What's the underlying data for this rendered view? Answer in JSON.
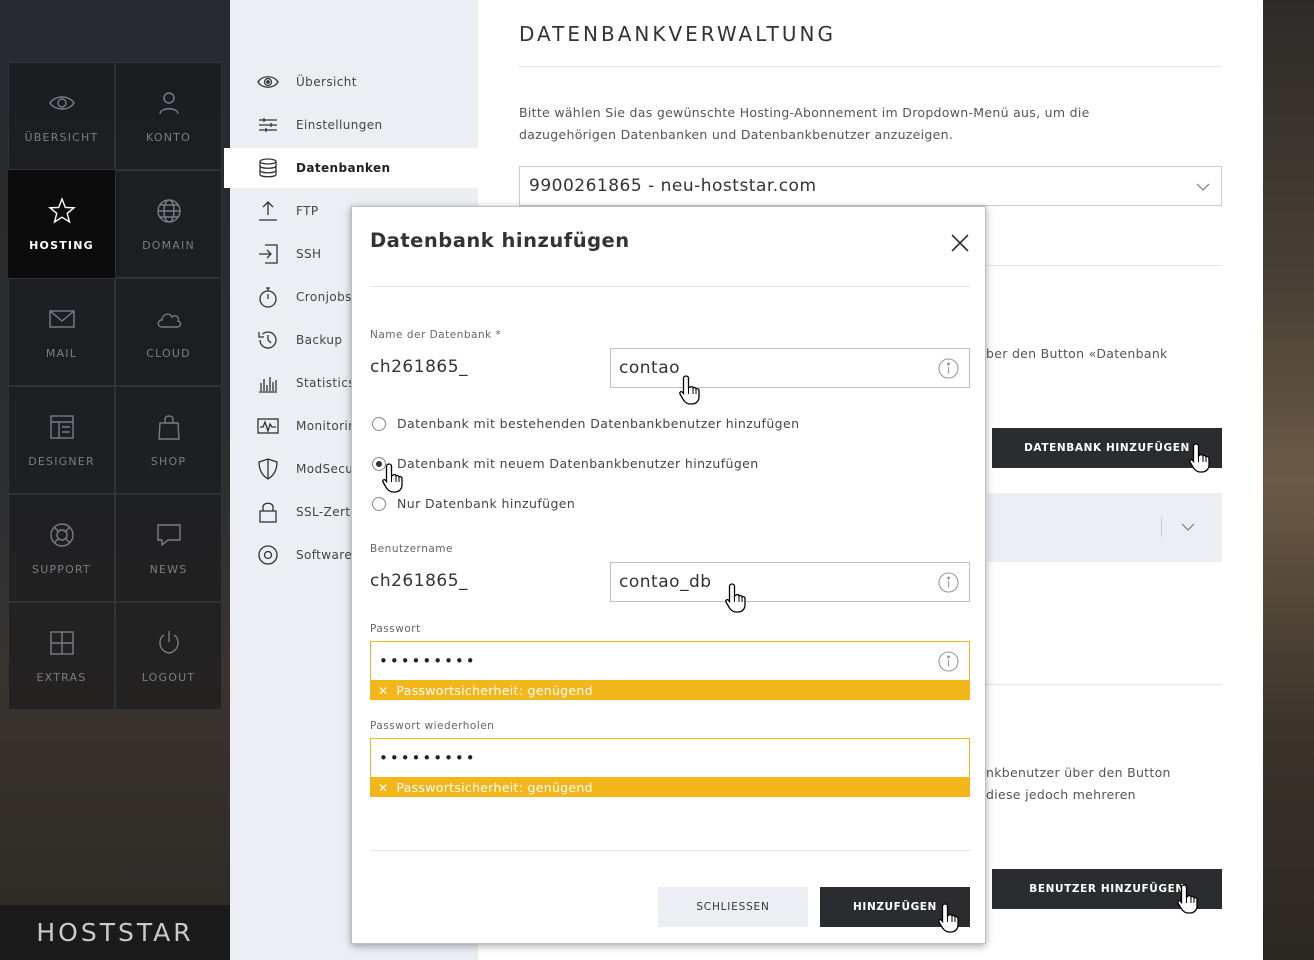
{
  "brand": {
    "logo_text": "HOSTSTAR"
  },
  "main_nav": [
    {
      "label": "ÜBERSICHT",
      "icon": "eye-icon"
    },
    {
      "label": "KONTO",
      "icon": "user-icon"
    },
    {
      "label": "HOSTING",
      "icon": "star-icon",
      "active": true
    },
    {
      "label": "DOMAIN",
      "icon": "globe-icon"
    },
    {
      "label": "MAIL",
      "icon": "mail-icon"
    },
    {
      "label": "CLOUD",
      "icon": "cloud-icon"
    },
    {
      "label": "DESIGNER",
      "icon": "layout-icon"
    },
    {
      "label": "SHOP",
      "icon": "shopping-bag-icon"
    },
    {
      "label": "SUPPORT",
      "icon": "lifebuoy-icon"
    },
    {
      "label": "NEWS",
      "icon": "speech-bubble-icon"
    },
    {
      "label": "EXTRAS",
      "icon": "plus-square-icon"
    },
    {
      "label": "LOGOUT",
      "icon": "power-icon"
    }
  ],
  "submenu": [
    {
      "label": "Übersicht",
      "icon": "eye-icon"
    },
    {
      "label": "Einstellungen",
      "icon": "sliders-icon"
    },
    {
      "label": "Datenbanken",
      "icon": "database-icon",
      "active": true
    },
    {
      "label": "FTP",
      "icon": "upload-icon"
    },
    {
      "label": "SSH",
      "icon": "login-icon"
    },
    {
      "label": "Cronjobs",
      "icon": "stopwatch-icon"
    },
    {
      "label": "Backup",
      "icon": "history-icon"
    },
    {
      "label": "Statistics",
      "icon": "bar-chart-icon"
    },
    {
      "label": "Monitoring",
      "icon": "pulse-icon"
    },
    {
      "label": "ModSecurity",
      "icon": "shield-icon"
    },
    {
      "label": "SSL-Zertifikate",
      "icon": "lock-icon"
    },
    {
      "label": "Software",
      "icon": "disc-icon"
    }
  ],
  "page": {
    "title": "DATENBANKVERWALTUNG",
    "intro": "Bitte wählen Sie das gewünschte Hosting-Abonnement im Dropdown-Menü aus, um die dazugehörigen Datenbanken und Datenbankbenutzer anzuzeigen.",
    "subscription_selected": "9900261865 - neu-hoststar.com",
    "bg_text_1": "ber den Button «Datenbank",
    "bg_text_2_line1": "nkbenutzer über den Button",
    "bg_text_2_line2": "diese jedoch mehreren",
    "add_db_button": "DATENBANK HINZUFÜGEN",
    "add_user_button": "BENUTZER HINZUFÜGEN"
  },
  "modal": {
    "title": "Datenbank hinzufügen",
    "db_name_label": "Name der Datenbank *",
    "db_prefix": "ch261865_",
    "db_name_value": "contao",
    "radio_options": [
      {
        "label": "Datenbank mit bestehenden Datenbankbenutzer hinzufügen",
        "checked": false
      },
      {
        "label": "Datenbank mit neuem Datenbankbenutzer hinzufügen",
        "checked": true
      },
      {
        "label": "Nur Datenbank hinzufügen",
        "checked": false
      }
    ],
    "username_label": "Benutzername",
    "user_prefix": "ch261865_",
    "username_value": "contao_db",
    "password_label": "Passwort",
    "password_value": "•••••••••",
    "password_strength": "Passwortsicherheit: genügend",
    "password_repeat_label": "Passwort wiederholen",
    "password_repeat_value": "•••••••••",
    "password_repeat_strength": "Passwortsicherheit: genügend",
    "close_button": "SCHLIESSEN",
    "submit_button": "HINZUFÜGEN"
  },
  "colors": {
    "accent_warning": "#f3b61b",
    "dark_button": "#2b2c2f",
    "submenu_bg": "#eceef4"
  }
}
